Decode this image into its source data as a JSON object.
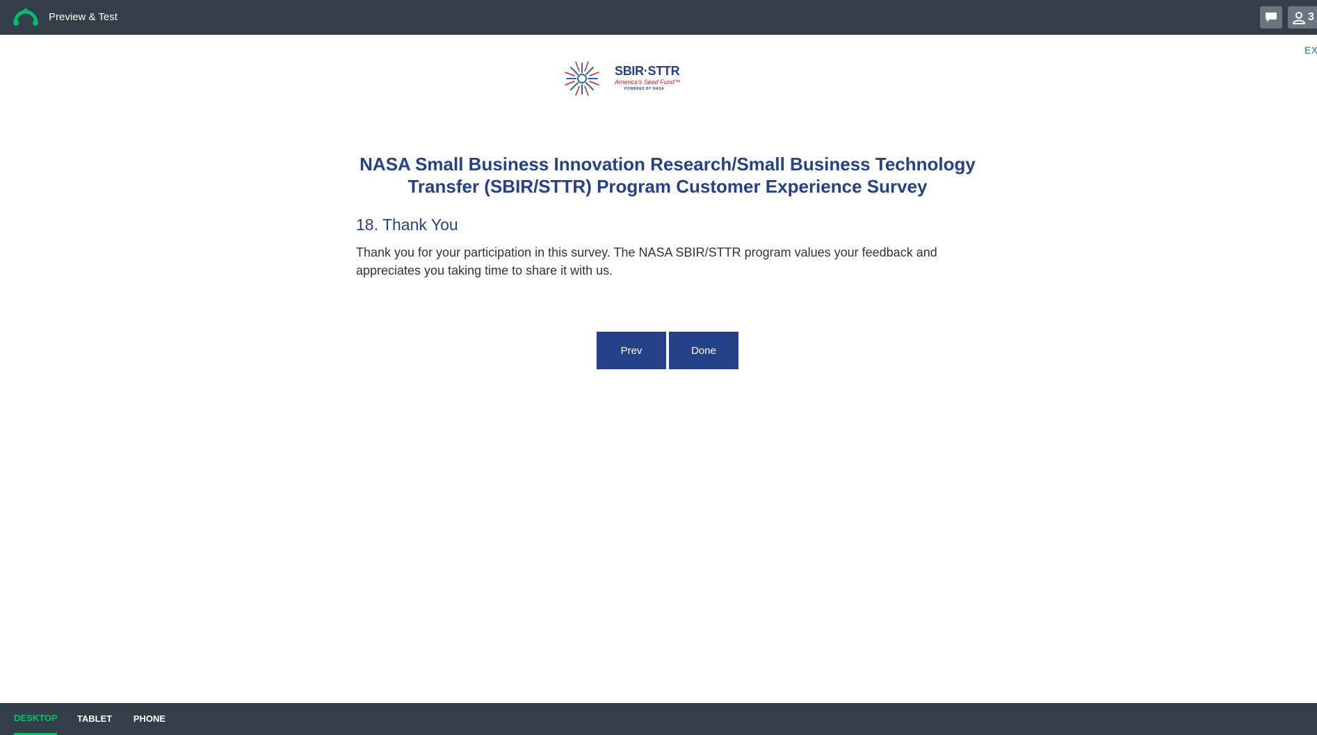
{
  "topbar": {
    "title": "Preview & Test",
    "user_count": "3"
  },
  "exit_link": "EX",
  "survey_logo": {
    "brand": "SBIR·STTR",
    "tagline": "America's Seed Fund™",
    "powered": "POWERED BY NASA"
  },
  "survey": {
    "title": "NASA Small Business Innovation Research/Small Business Technology Transfer (SBIR/STTR) Program Customer Experience Survey",
    "page_heading": "18. Thank You",
    "body": "Thank you for your participation in this survey. The NASA SBIR/STTR program values your feedback and appreciates you taking time to share it with us.",
    "prev_label": "Prev",
    "done_label": "Done"
  },
  "device_tabs": {
    "desktop": "DESKTOP",
    "tablet": "TABLET",
    "phone": "PHONE",
    "active": "desktop"
  },
  "colors": {
    "topbar_bg": "#333e48",
    "accent_green": "#00bf6f",
    "survey_blue": "#24418a"
  },
  "icons": {
    "app_logo": "surveymonkey-logo-icon",
    "comment": "comment-icon",
    "user": "user-icon"
  }
}
